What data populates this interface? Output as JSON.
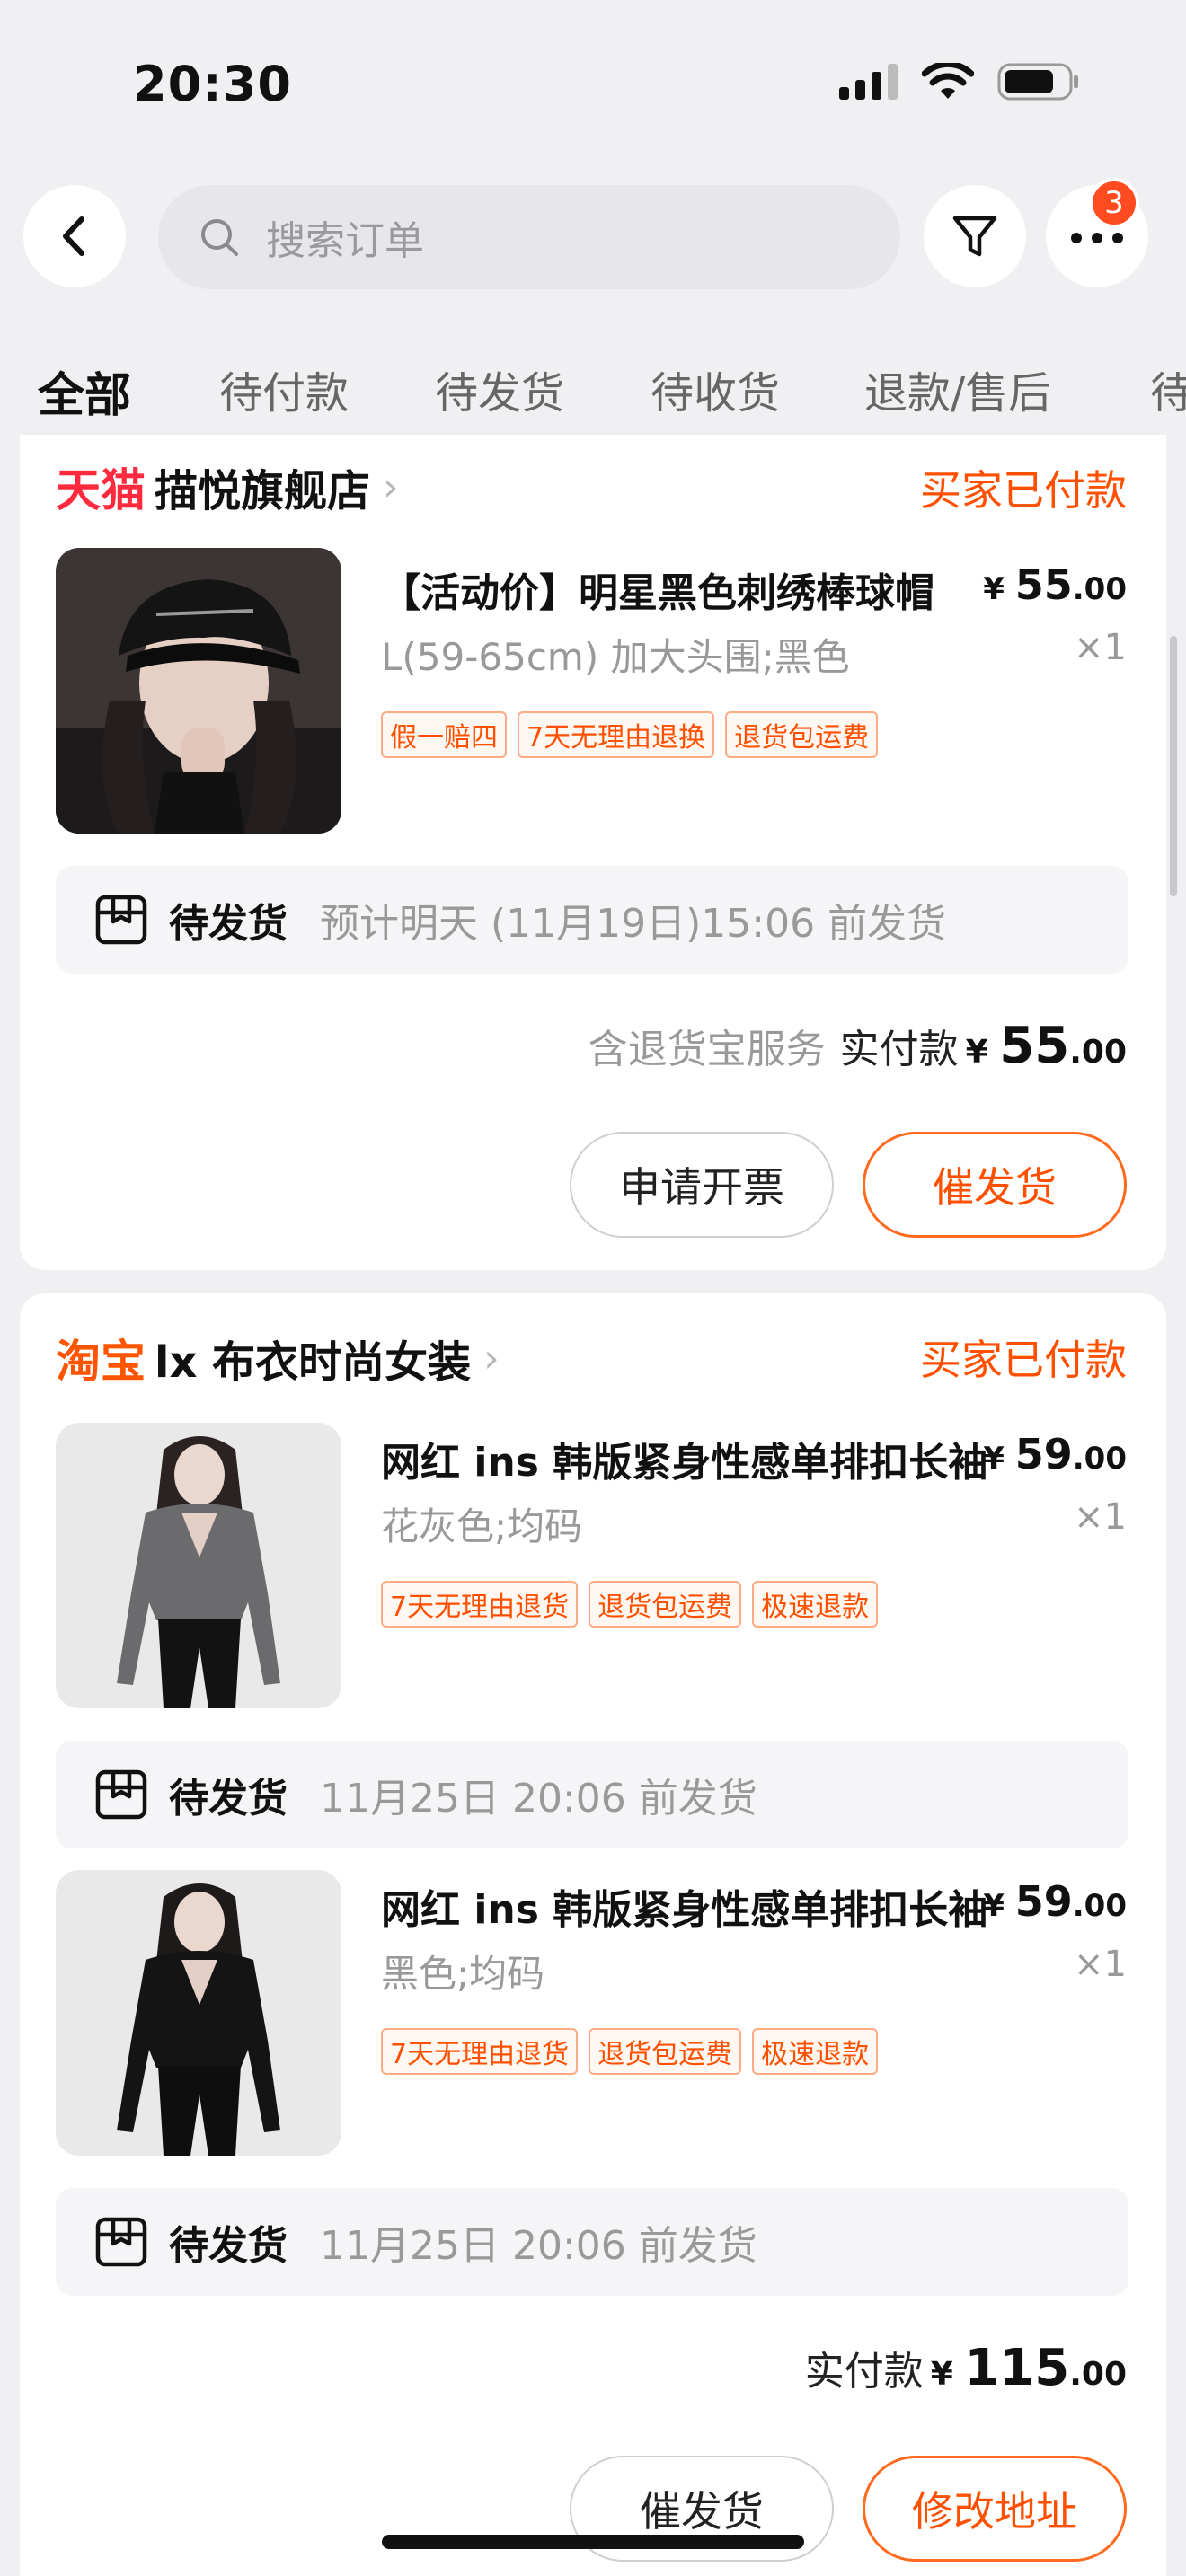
{
  "status_bar": {
    "time": "20:30"
  },
  "header": {
    "search_placeholder": "搜索订单",
    "notification_count": "3"
  },
  "tabs": [
    "全部",
    "待付款",
    "待发货",
    "待收货",
    "退款/售后",
    "待"
  ],
  "orders": [
    {
      "brand": "天猫",
      "shop": "描悦旗舰店",
      "status": "买家已付款",
      "items": [
        {
          "title": "【活动价】明星黑色刺绣棒球帽",
          "price_symbol": "¥",
          "price_int": "55",
          "price_dec": ".00",
          "sku": "L(59-65cm) 加大头围;黑色",
          "qty": "×1",
          "tags": [
            "假一赔四",
            "7天无理由退换",
            "退货包运费"
          ]
        }
      ],
      "shipping": {
        "label": "待发货",
        "note": "预计明天 (11月19日)15:06 前发货"
      },
      "payment": {
        "note": "含退货宝服务",
        "label": "实付款",
        "symbol": "¥",
        "int": "55",
        "dec": ".00"
      },
      "buttons": [
        "申请开票",
        "催发货"
      ]
    },
    {
      "brand": "淘宝",
      "shop": "lx 布衣时尚女装",
      "status": "买家已付款",
      "items": [
        {
          "title": "网红 ins 韩版紧身性感单排扣长袖",
          "price_symbol": "¥",
          "price_int": "59",
          "price_dec": ".00",
          "sku": "花灰色;均码",
          "qty": "×1",
          "tags": [
            "7天无理由退货",
            "退货包运费",
            "极速退款"
          ],
          "shipping": {
            "label": "待发货",
            "note": "11月25日 20:06 前发货"
          }
        },
        {
          "title": "网红 ins 韩版紧身性感单排扣长袖",
          "price_symbol": "¥",
          "price_int": "59",
          "price_dec": ".00",
          "sku": "黑色;均码",
          "qty": "×1",
          "tags": [
            "7天无理由退货",
            "退货包运费",
            "极速退款"
          ],
          "shipping": {
            "label": "待发货",
            "note": "11月25日 20:06 前发货"
          }
        }
      ],
      "payment": {
        "label": "实付款",
        "symbol": "¥",
        "int": "115",
        "dec": ".00"
      },
      "buttons": [
        "催发货",
        "修改地址"
      ]
    }
  ],
  "colors": {
    "accent": "#ff5000",
    "tmall": "#ff2a3d",
    "background": "#f0f0f2"
  },
  "icons": [
    "back-icon",
    "search-icon",
    "filter-icon",
    "more-icon",
    "package-icon",
    "chevron-right-icon"
  ]
}
